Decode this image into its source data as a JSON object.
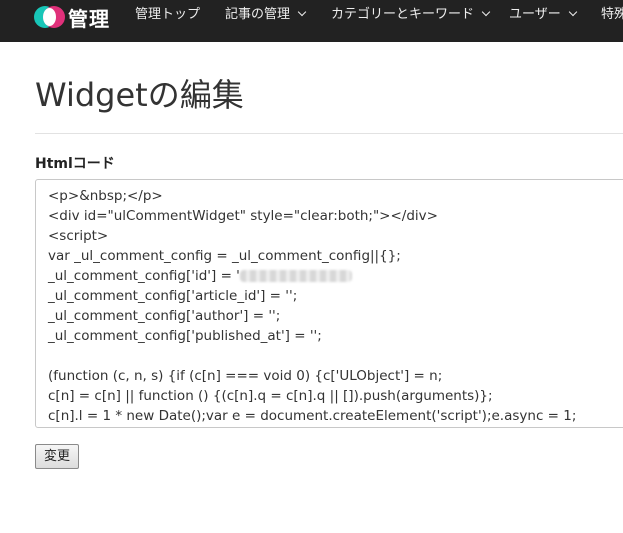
{
  "navbar": {
    "logo_text": "管理",
    "items": [
      {
        "label": "管理トップ",
        "dropdown": false
      },
      {
        "label": "記事の管理",
        "dropdown": true
      },
      {
        "label": "カテゴリーとキーワード",
        "dropdown": true
      },
      {
        "label": "ユーザー",
        "dropdown": true
      },
      {
        "label": "特殊",
        "dropdown": false
      }
    ],
    "background": "#222222",
    "logo_colors": [
      "#18c6b8",
      "#e0307a"
    ]
  },
  "page": {
    "title": "Widgetの編集",
    "field_label": "Htmlコード",
    "submit_label": "変更"
  },
  "code_lines": [
    "<p>&nbsp;</p>",
    "<div id=\"ulCommentWidget\" style=\"clear:both;\"></div>",
    "<script>",
    "var _ul_comment_config = _ul_comment_config||{};",
    "_ul_comment_config['id'] = '",
    "_ul_comment_config['article_id'] = '';",
    "_ul_comment_config['author'] = '';",
    "_ul_comment_config['published_at'] = '';",
    "",
    "(function (c, n, s) {if (c[n] === void 0) {c['ULObject'] = n;",
    "c[n] = c[n] || function () {(c[n].q = c[n].q || []).push(arguments)};",
    "c[n].l = 1 * new Date();var e = document.createElement('script');e.async = 1;"
  ]
}
